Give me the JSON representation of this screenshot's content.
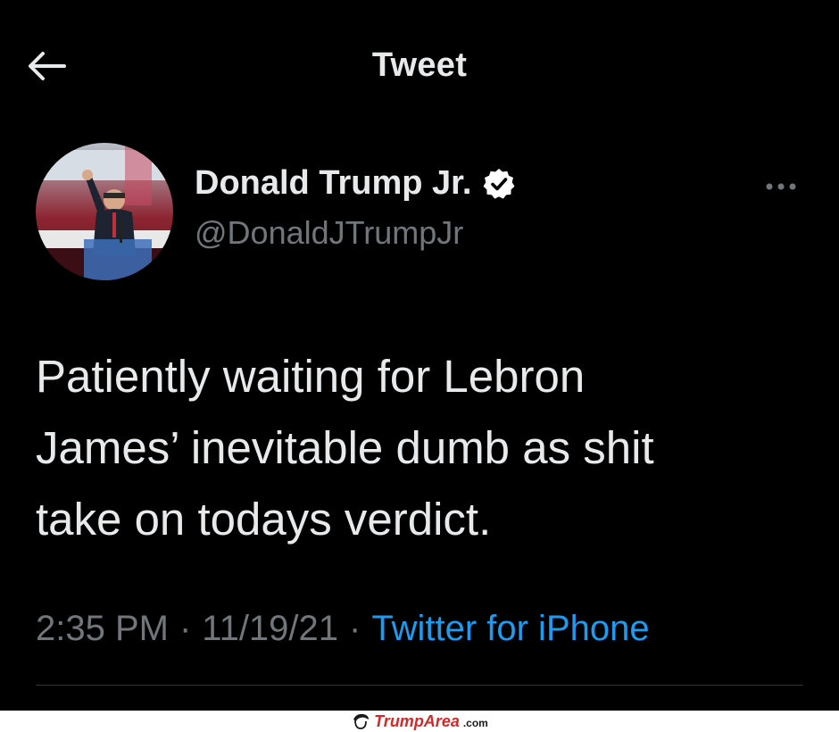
{
  "header": {
    "title": "Tweet",
    "back_icon": "arrow-left-icon"
  },
  "author": {
    "display_name": "Donald Trump Jr.",
    "handle": "@DonaldJTrumpJr",
    "verified": true
  },
  "tweet": {
    "lines": [
      "Patiently waiting for Lebron",
      "James’ inevitable dumb as shit",
      "take on todays verdict."
    ]
  },
  "meta": {
    "time": "2:35 PM",
    "separator": "·",
    "date": "11/19/21",
    "source": "Twitter for iPhone"
  },
  "watermark": {
    "brand": "TrumpArea",
    "domain": ".com"
  },
  "colors": {
    "background": "#000000",
    "text_primary": "#e7e9ea",
    "text_secondary": "#71767b",
    "link": "#1d9bf0",
    "watermark_red": "#d62828"
  }
}
